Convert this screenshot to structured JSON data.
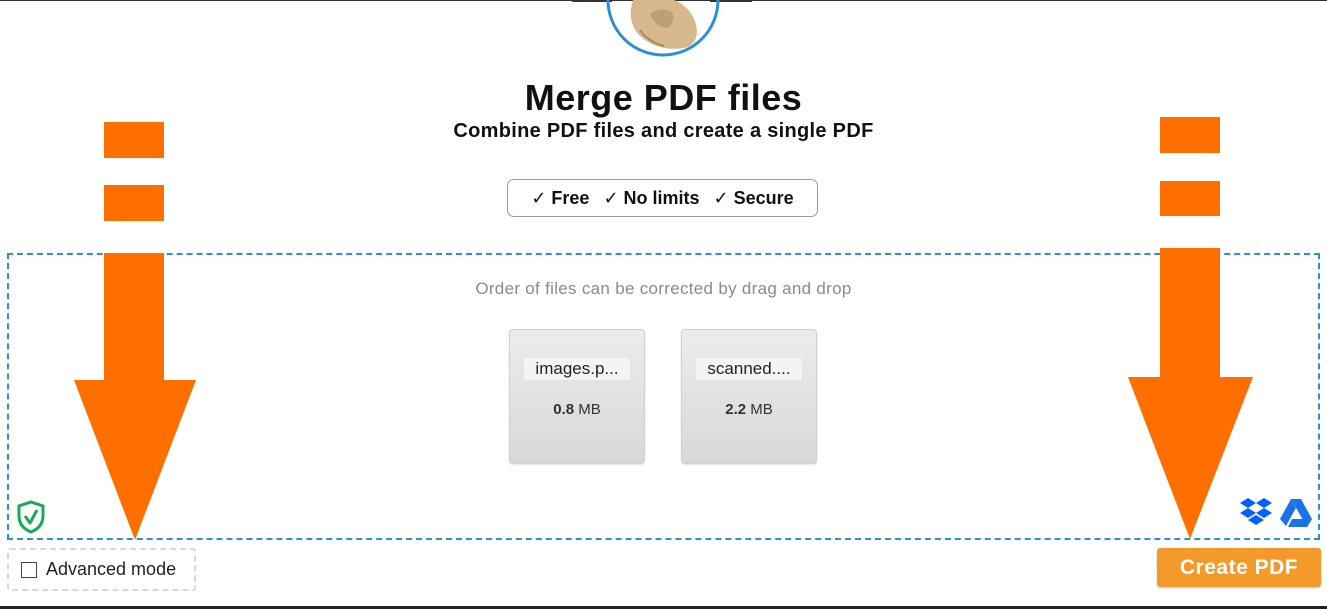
{
  "header": {
    "title": "Merge PDF files",
    "subtitle": "Combine PDF files and create a single PDF"
  },
  "features": [
    {
      "check": "✓",
      "label": "Free"
    },
    {
      "check": "✓",
      "label": "No limits"
    },
    {
      "check": "✓",
      "label": "Secure"
    }
  ],
  "dropzone": {
    "hint": "Order of files can be corrected by drag and drop",
    "files": [
      {
        "name": "images.p...",
        "size_value": "0.8",
        "size_unit": "MB"
      },
      {
        "name": "scanned....",
        "size_value": "2.2",
        "size_unit": "MB"
      }
    ]
  },
  "options": {
    "advanced_mode_label": "Advanced mode",
    "advanced_mode_checked": false
  },
  "actions": {
    "create_label": "Create PDF"
  },
  "colors": {
    "accent_orange": "#f39a2a",
    "annotation_arrow": "#ff6f00",
    "dropzone_border": "#2b90d9",
    "shield_green": "#1aaa55",
    "dropbox_blue": "#0061fe",
    "drive_blue": "#1a73e8"
  },
  "icons": {
    "mascot": "mascot-icon",
    "shield": "shield-check-icon",
    "dropbox": "dropbox-icon",
    "drive": "google-drive-icon"
  }
}
